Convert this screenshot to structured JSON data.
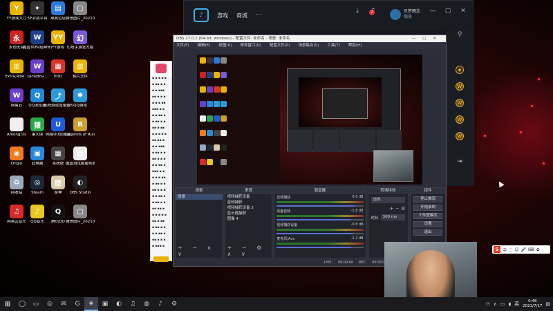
{
  "desktop_icons": [
    {
      "label": "YY游戏大厅",
      "color": "#e8b400",
      "glyph": "Y"
    },
    {
      "label": "5E对战平台",
      "color": "#333",
      "glyph": "✦"
    },
    {
      "label": "桌面垃圾",
      "color": "#2a7ad8",
      "glyph": "▤"
    },
    {
      "label": "微信图片_2021071...",
      "color": "#888",
      "glyph": "▢"
    },
    {
      "label": "永劫无间",
      "color": "#c22",
      "glyph": "永"
    },
    {
      "label": "魔兽世界(经典怀旧服)",
      "color": "#1f3f8a",
      "glyph": "W"
    },
    {
      "label": "YY游戏",
      "color": "#e8b400",
      "glyph": "YY"
    },
    {
      "label": "幻塔手游官方版",
      "color": "#7a5ad8",
      "glyph": "幻"
    },
    {
      "label": "Extra,Role...",
      "color": "#e8b400",
      "glyph": "▥"
    },
    {
      "label": "tacledov...",
      "color": "#6a3fc8",
      "glyph": "W"
    },
    {
      "label": "PDD",
      "color": "#d8342a",
      "glyph": "▦"
    },
    {
      "label": "相片文件",
      "color": "#e8b400",
      "glyph": "▥"
    },
    {
      "label": "网易云",
      "color": "#6a3fc8",
      "glyph": "W"
    },
    {
      "label": "QQ浏览器",
      "color": "#1f8ad8",
      "glyph": "Q"
    },
    {
      "label": "玩吧游戏加速器8.0",
      "color": "#2a9ad8",
      "glyph": "⤴"
    },
    {
      "label": "QQ游戏",
      "color": "#2a9ad8",
      "glyph": "✱"
    },
    {
      "label": "Among Us",
      "color": "#eee",
      "glyph": "▢"
    },
    {
      "label": "猿大侠",
      "color": "#2aa84a",
      "glyph": "猿"
    },
    {
      "label": "网易UU加速器",
      "color": "#1f5ad8",
      "glyph": "U"
    },
    {
      "label": "Legends of Runeterra",
      "color": "#c8a030",
      "glyph": "R"
    },
    {
      "label": "Origin",
      "color": "#f07a20",
      "glyph": "◉"
    },
    {
      "label": "此电脑",
      "color": "#2a8ad8",
      "glyph": "▣"
    },
    {
      "label": "系统牌",
      "color": "#444",
      "glyph": "▦"
    },
    {
      "label": "魔兽测试服服务器",
      "color": "#eee",
      "glyph": "▤"
    },
    {
      "label": "回收站",
      "color": "#9ab",
      "glyph": "♻"
    },
    {
      "label": "Steam",
      "color": "#1b2838",
      "glyph": "◎"
    },
    {
      "label": "原神",
      "color": "#d8c8a8",
      "glyph": "原"
    },
    {
      "label": "OBS Studio",
      "color": "#222",
      "glyph": "◐"
    },
    {
      "label": "网易云音乐",
      "color": "#d82a2a",
      "glyph": "♫"
    },
    {
      "label": "QQ音乐",
      "color": "#e8c820",
      "glyph": "♪"
    },
    {
      "label": "腾讯QQ",
      "color": "#111",
      "glyph": "Q"
    },
    {
      "label": "微信图片_2021071...",
      "color": "#888",
      "glyph": "▢"
    }
  ],
  "client": {
    "nav": [
      "游戏",
      "商城"
    ],
    "more": "···",
    "notification_count": "2",
    "user_name": "贝梦雨忘",
    "user_status": "隐身"
  },
  "obs": {
    "title": "OBS 27.0.1 (64-bit, windows) - 配置文件: 未命名 - 场景: 未命名",
    "menu": [
      "文件(F)",
      "编辑(E)",
      "视图(V)",
      "停靠窗口(D)",
      "配置文件(P)",
      "场景集合(S)",
      "工具(T)",
      "帮助(H)"
    ],
    "docks": {
      "scenes_title": "场景",
      "scenes": [
        "场景"
      ],
      "sources_title": "来源",
      "sources": [
        "视频捕获设备",
        "音频捕获",
        "视频捕获设备 2",
        "显示器捕获",
        "图像 4"
      ],
      "mixer_title": "混音器",
      "mixer_tracks": [
        {
          "name": "音频捕获",
          "db": "0.0 dB",
          "vol": 0.9
        },
        {
          "name": "桌面音频",
          "db": "-1.8 dB",
          "vol": 0.85
        },
        {
          "name": "视频捕获设备",
          "db": "-0.8 dB",
          "vol": 0.88
        },
        {
          "name": "麦克风/Aux",
          "db": "-1.2 dB",
          "vol": 0.86
        }
      ],
      "transitions_title": "转场特效",
      "transition_type": "淡出",
      "duration_label": "时长",
      "duration_value": "300 ms",
      "controls_title": "控件",
      "controls": [
        "停止推流",
        "开始录制",
        "工作室模式",
        "设置",
        "退出"
      ]
    },
    "status": "LIVE: 00:00:00  REC: 00:00:00  CPU: 2.3%, 30.00 fps"
  },
  "ime": {
    "logo": "S",
    "label": "中"
  },
  "taskbar": {
    "start": "⊞",
    "icons": [
      "◯",
      "▭",
      "◎",
      "✉",
      "G",
      "◈",
      "▣",
      "◐",
      "♫",
      "◍",
      "♪",
      "⚙"
    ],
    "time": "0:48",
    "date": "2021/7/17"
  },
  "colors": {
    "accent": "#3fb3e6",
    "obs_bg": "#2b2e38",
    "desktop_red": "#5a0c0c"
  }
}
